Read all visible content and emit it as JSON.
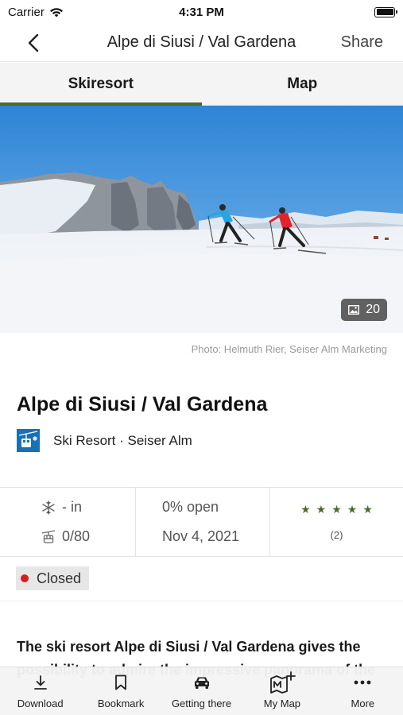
{
  "status_bar": {
    "carrier": "Carrier",
    "time": "4:31 PM"
  },
  "nav": {
    "title": "Alpe di Siusi / Val Gardena",
    "share_label": "Share"
  },
  "tabs": [
    {
      "label": "Skiresort",
      "active": true
    },
    {
      "label": "Map",
      "active": false
    }
  ],
  "hero": {
    "photo_count": "20",
    "credit": "Photo: Helmuth Rier, Seiser Alm Marketing"
  },
  "resort": {
    "title": "Alpe di Siusi / Val Gardena",
    "category": "Ski Resort · Seiser Alm"
  },
  "stats": {
    "snow": "- in",
    "lifts": "0/80",
    "open_percent": "0% open",
    "date": "Nov 4, 2021",
    "rating_stars": 5,
    "rating_count": "(2)"
  },
  "status": {
    "label": "Closed",
    "color": "#d21f1f"
  },
  "description": "The ski resort Alpe di Siusi / Val Gardena gives the possibility to admire the impressive panorama of the",
  "toolbar": {
    "items": [
      {
        "label": "Download",
        "icon": "download-icon"
      },
      {
        "label": "Bookmark",
        "icon": "bookmark-icon"
      },
      {
        "label": "Getting there",
        "icon": "car-icon"
      },
      {
        "label": "My Map",
        "icon": "my-map-icon"
      },
      {
        "label": "More",
        "icon": "more-icon"
      }
    ]
  },
  "colors": {
    "accent": "#4c6a2a",
    "resort_icon_bg": "#1a6fb5",
    "closed_dot": "#d21f1f"
  }
}
